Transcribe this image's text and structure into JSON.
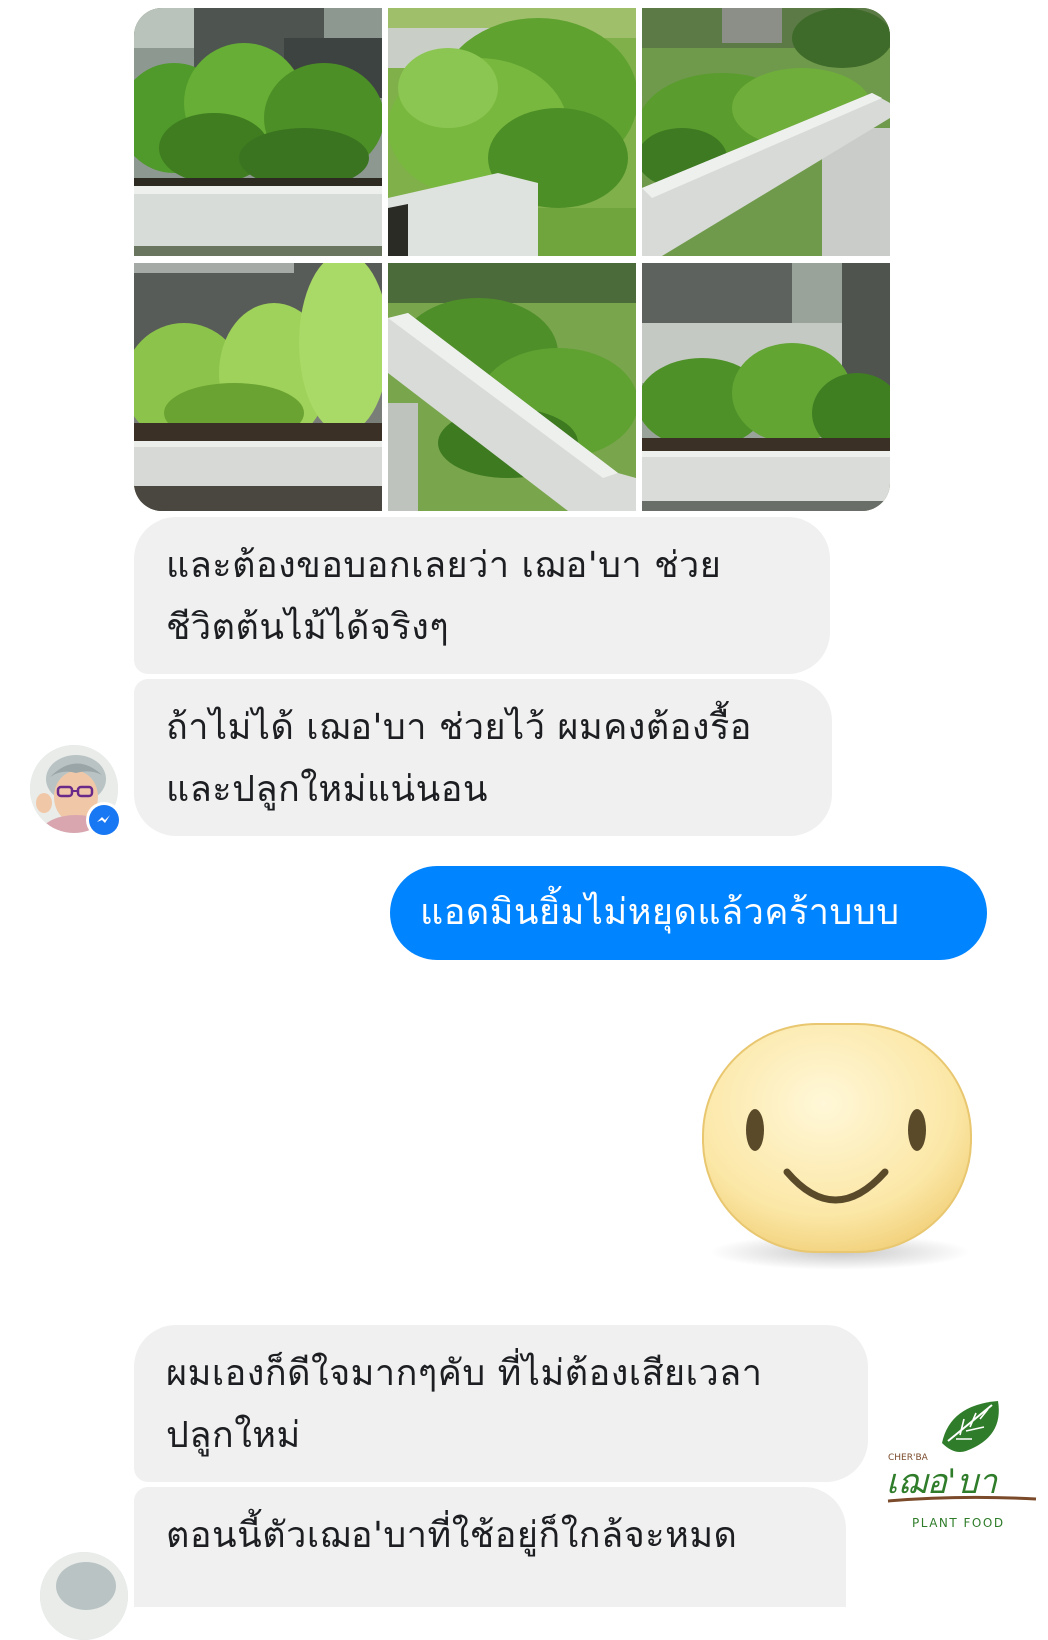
{
  "conversation": {
    "photos": [
      {
        "label": "raised-planter-photo-1"
      },
      {
        "label": "raised-planter-photo-2"
      },
      {
        "label": "raised-planter-photo-3"
      },
      {
        "label": "raised-planter-photo-4"
      },
      {
        "label": "raised-planter-photo-5"
      },
      {
        "label": "raised-planter-photo-6"
      }
    ],
    "messages": [
      {
        "sender": "customer",
        "text": "และต้องขอบอกเลยว่า เฌอ'บา ช่วย\nชีวิตต้นไม้ได้จริงๆ"
      },
      {
        "sender": "customer",
        "text": "ถ้าไม่ได้ เฌอ'บา ช่วยไว้ ผมคงต้องรื้อ\nและปลูกใหม่แน่นอน"
      },
      {
        "sender": "admin",
        "text": "แอดมินยิ้มไม่หยุดแล้วคร้าบบบ"
      },
      {
        "sender": "customer",
        "text": "ผมเองก็ดีใจมากๆคับ ที่ไม่ต้องเสียเวลา\nปลูกใหม่"
      },
      {
        "sender": "customer",
        "text": "ตอนนี้ตัวเฌอ'บาที่ใช้อยู่ก็ใกล้จะหมด"
      }
    ],
    "sticker": {
      "icon": "smiley-face-sticker"
    },
    "badge": {
      "icon": "messenger-icon"
    }
  },
  "watermark": {
    "small_text": "CHER'BA",
    "brand_text": "เฌอ'บา",
    "tagline": "PLANT FOOD",
    "icon": "leaf-icon"
  },
  "colors": {
    "outgoing_bubble": "#0084ff",
    "incoming_bubble": "#f0f0f0",
    "messenger_badge": "#1877f2",
    "brand_green": "#2f7d2a",
    "brand_brown": "#7a4a2a"
  }
}
